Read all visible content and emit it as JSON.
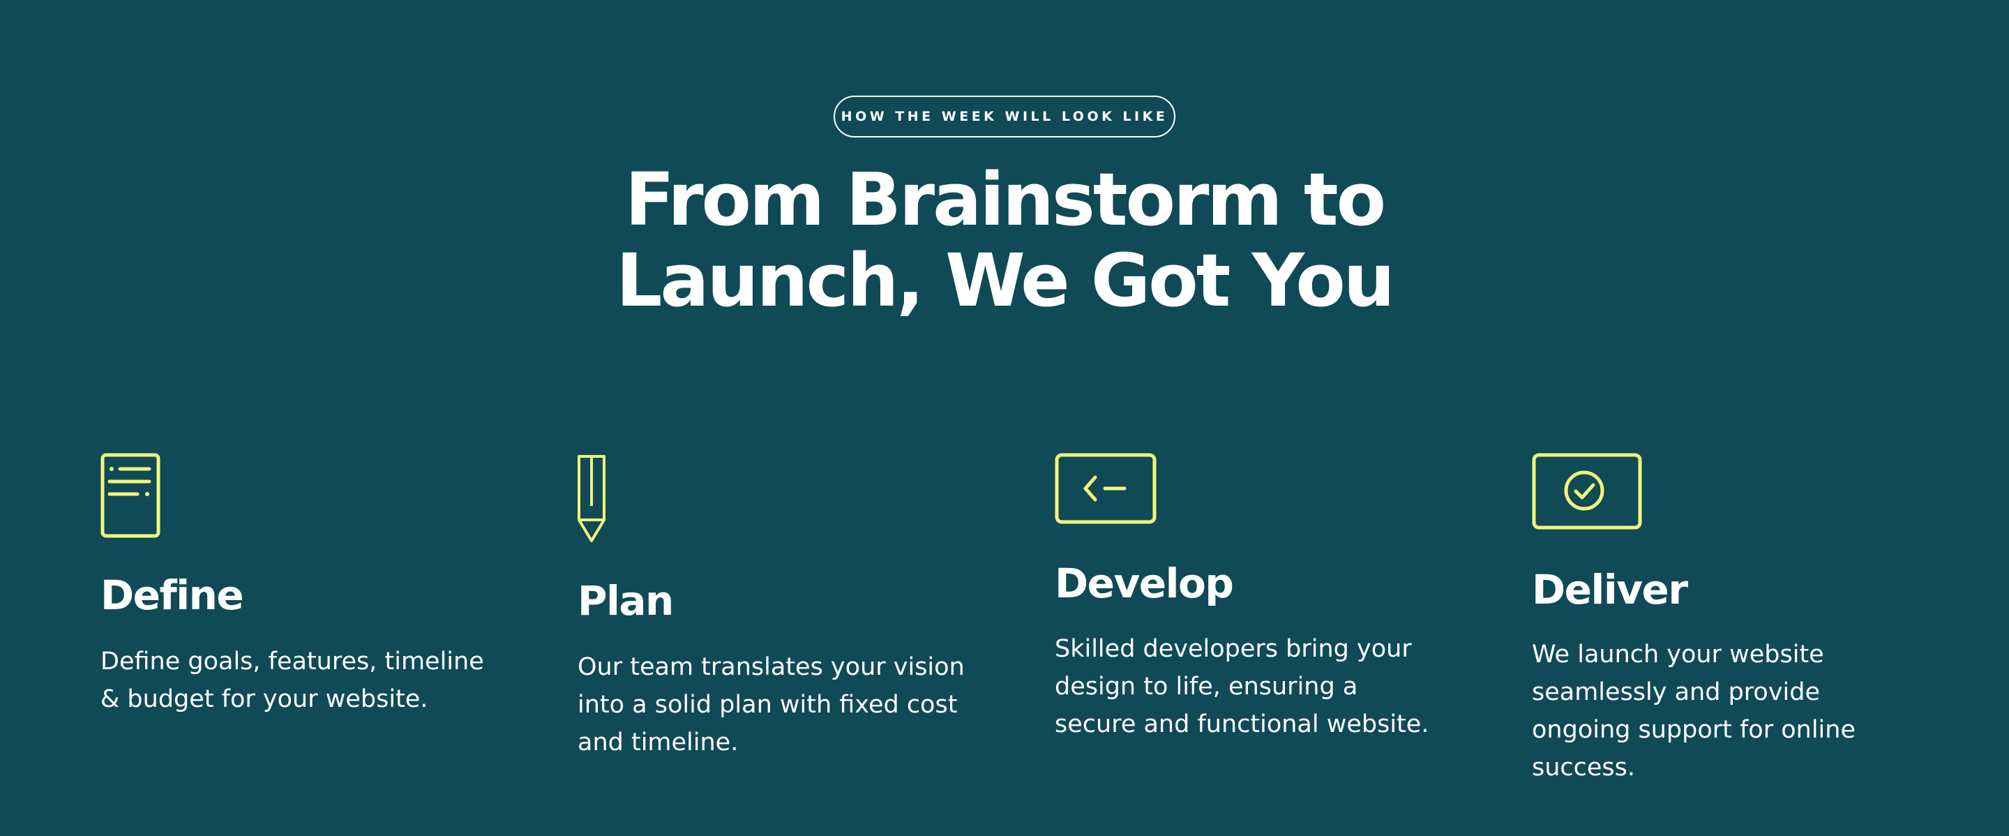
{
  "section": {
    "eyebrow": "HOW THE WEEK WILL LOOK LIKE",
    "title_line1": "From Brainstorm to",
    "title_line2": "Launch, We Got You"
  },
  "colors": {
    "background": "#0f4a56",
    "accent": "#f3f57a",
    "text": "#ffffff"
  },
  "steps": [
    {
      "icon": "document-icon",
      "title": "Define",
      "description": "Define goals, features, timeline & budget for your website."
    },
    {
      "icon": "pencil-icon",
      "title": "Plan",
      "description": "Our team translates your vision into a solid plan with fixed cost and timeline."
    },
    {
      "icon": "code-window-icon",
      "title": "Develop",
      "description": "Skilled developers bring your design to life, ensuring a secure and functional website."
    },
    {
      "icon": "checkmark-window-icon",
      "title": "Deliver",
      "description": "We launch your website seamlessly and provide ongoing support for online success."
    }
  ]
}
